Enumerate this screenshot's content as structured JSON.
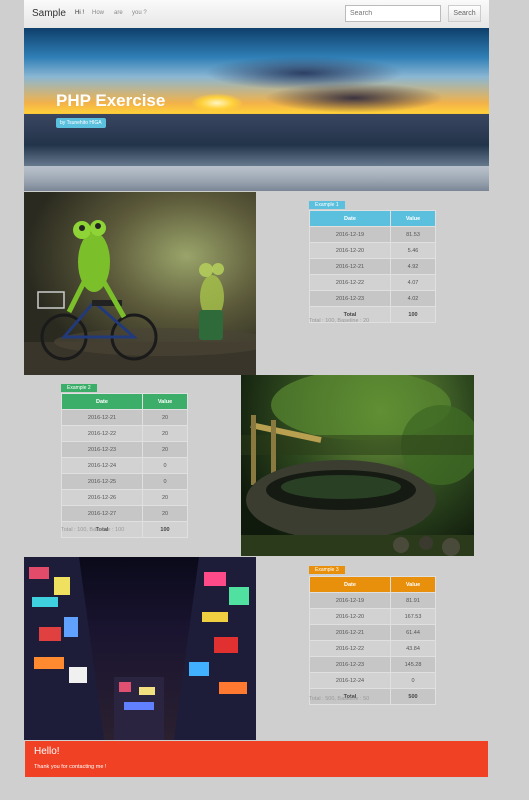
{
  "navbar": {
    "brand": "Sample",
    "links": [
      "Hi !",
      "How",
      "are",
      "you ?"
    ],
    "search_placeholder": "Search",
    "search_button": "Search"
  },
  "hero": {
    "title": "PHP Exercise",
    "byline": "by Tsunehito HIGA"
  },
  "examples": [
    {
      "label": "Example 1",
      "color": "#5bc0de",
      "headers": [
        "Date",
        "Value"
      ],
      "rows": [
        [
          "2016-12-19",
          "81.53"
        ],
        [
          "2016-12-20",
          "5.46"
        ],
        [
          "2016-12-21",
          "4.92"
        ],
        [
          "2016-12-22",
          "4.07"
        ],
        [
          "2016-12-23",
          "4.02"
        ]
      ],
      "total_label": "Total",
      "total_value": "100",
      "summary": "Total : 100, Baseline : 20"
    },
    {
      "label": "Example 2",
      "color": "#3cae6a",
      "headers": [
        "Date",
        "Value"
      ],
      "rows": [
        [
          "2016-12-21",
          "20"
        ],
        [
          "2016-12-22",
          "20"
        ],
        [
          "2016-12-23",
          "20"
        ],
        [
          "2016-12-24",
          "0"
        ],
        [
          "2016-12-25",
          "0"
        ],
        [
          "2016-12-26",
          "20"
        ],
        [
          "2016-12-27",
          "20"
        ]
      ],
      "total_label": "Total",
      "total_value": "100",
      "summary": "Total : 100, Baseline : 100"
    },
    {
      "label": "Example 3",
      "color": "#e8900c",
      "headers": [
        "Date",
        "Value"
      ],
      "rows": [
        [
          "2016-12-19",
          "81.91"
        ],
        [
          "2016-12-20",
          "167.53"
        ],
        [
          "2016-12-21",
          "61.44"
        ],
        [
          "2016-12-22",
          "43.84"
        ],
        [
          "2016-12-23",
          "145.28"
        ],
        [
          "2016-12-24",
          "0"
        ]
      ],
      "total_label": "Total",
      "total_value": "500",
      "summary": "Total : 500, Baseline : 50"
    }
  ],
  "footer": {
    "title": "Hello!",
    "text": "Thank you for contacting me !",
    "color": "#f04124"
  }
}
